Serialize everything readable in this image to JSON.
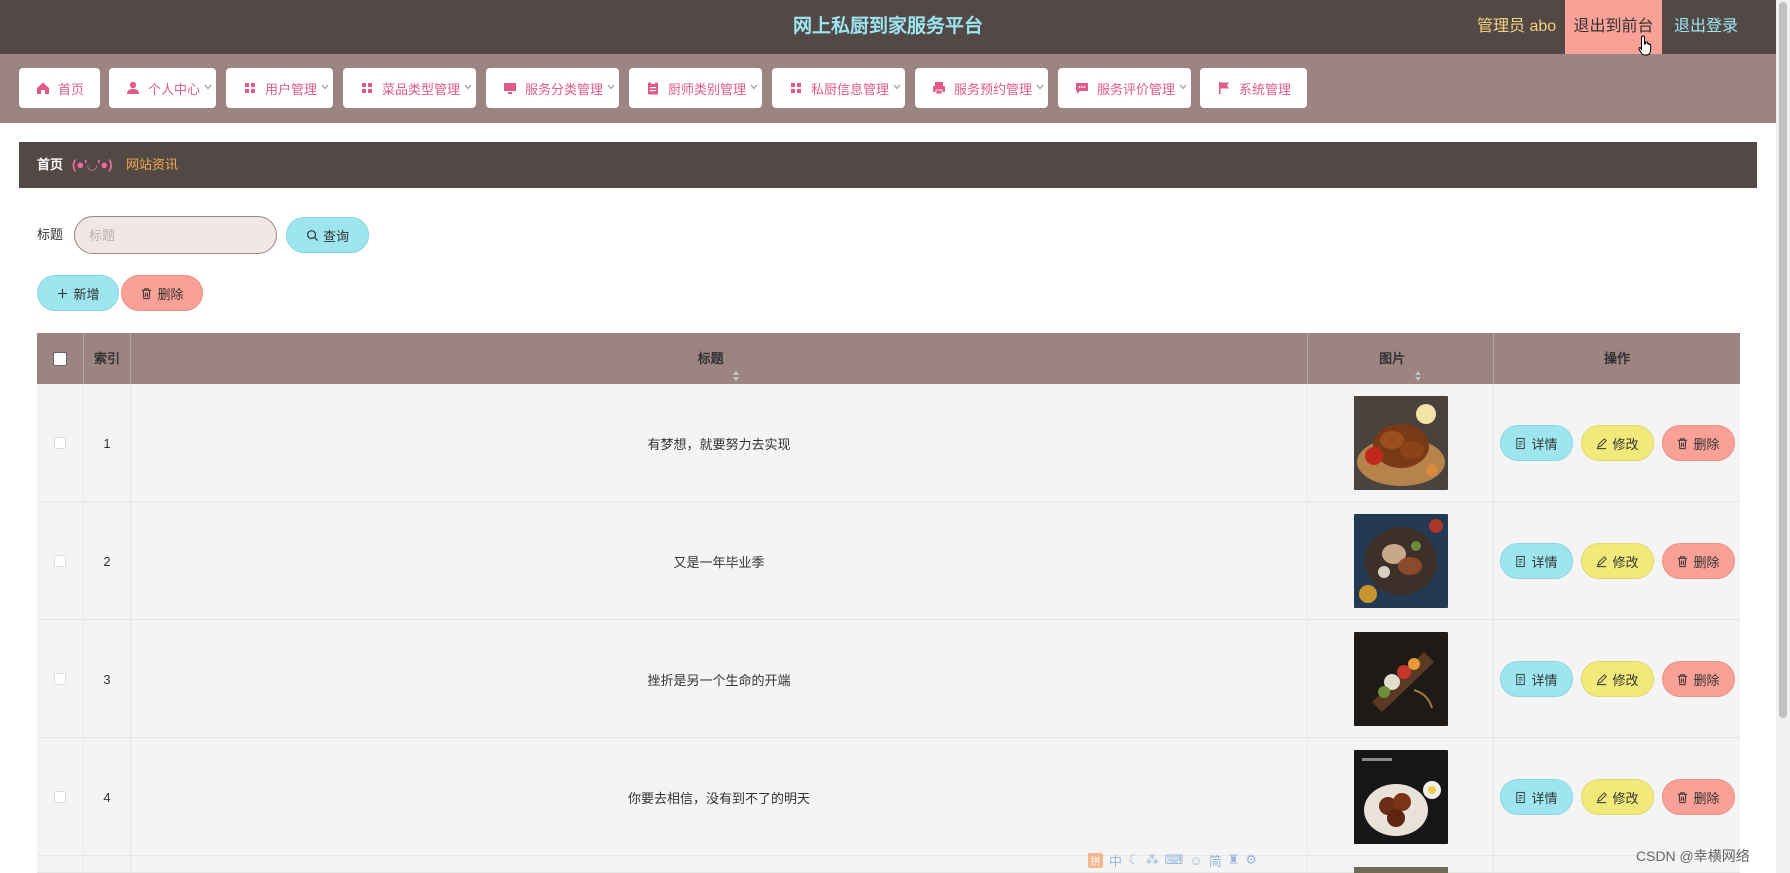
{
  "header": {
    "title": "网上私厨到家服务平台",
    "user": "管理员 abo",
    "front_label": "退出到前台",
    "logout_label": "退出登录"
  },
  "nav": [
    {
      "label": "首页",
      "icon": "home-icon"
    },
    {
      "label": "个人中心",
      "icon": "user-icon"
    },
    {
      "label": "用户管理",
      "icon": "grid-icon"
    },
    {
      "label": "菜品类型管理",
      "icon": "grid-icon"
    },
    {
      "label": "服务分类管理",
      "icon": "monitor-icon"
    },
    {
      "label": "厨师类别管理",
      "icon": "clipboard-icon"
    },
    {
      "label": "私厨信息管理",
      "icon": "grid-icon"
    },
    {
      "label": "服务预约管理",
      "icon": "printer-icon"
    },
    {
      "label": "服务评价管理",
      "icon": "chat-icon"
    },
    {
      "label": "系统管理",
      "icon": "flag-icon"
    }
  ],
  "breadcrumb": {
    "home": "首页",
    "emoticon": "(●'◡'●)",
    "current": "网站资讯"
  },
  "search": {
    "label": "标题",
    "placeholder": "标题",
    "button": "查询"
  },
  "actions": {
    "add": "新增",
    "delete": "删除"
  },
  "table": {
    "columns": {
      "index": "索引",
      "title": "标题",
      "image": "图片",
      "ops": "操作"
    },
    "rows": [
      {
        "index": "1",
        "title": "有梦想，就要努力去实现",
        "image": "roast-chicken-photo"
      },
      {
        "index": "2",
        "title": "又是一年毕业季",
        "image": "platter-photo"
      },
      {
        "index": "3",
        "title": "挫折是另一个生命的开端",
        "image": "skewer-photo"
      },
      {
        "index": "4",
        "title": "你要去相信，没有到不了的明天",
        "image": "meatball-bowl-photo"
      }
    ],
    "row_actions": {
      "detail": "详情",
      "edit": "修改",
      "delete": "删除"
    }
  },
  "ime_toolbar": [
    "中",
    "简"
  ],
  "watermark": "CSDN @幸横网络",
  "colors": {
    "topbar": "#524846",
    "nav_bg": "#9c8580",
    "accent_cyan": "#9de6f0",
    "accent_pink": "#f9a196",
    "accent_yellow": "#f1e97a",
    "nav_text": "#e05a8a"
  }
}
